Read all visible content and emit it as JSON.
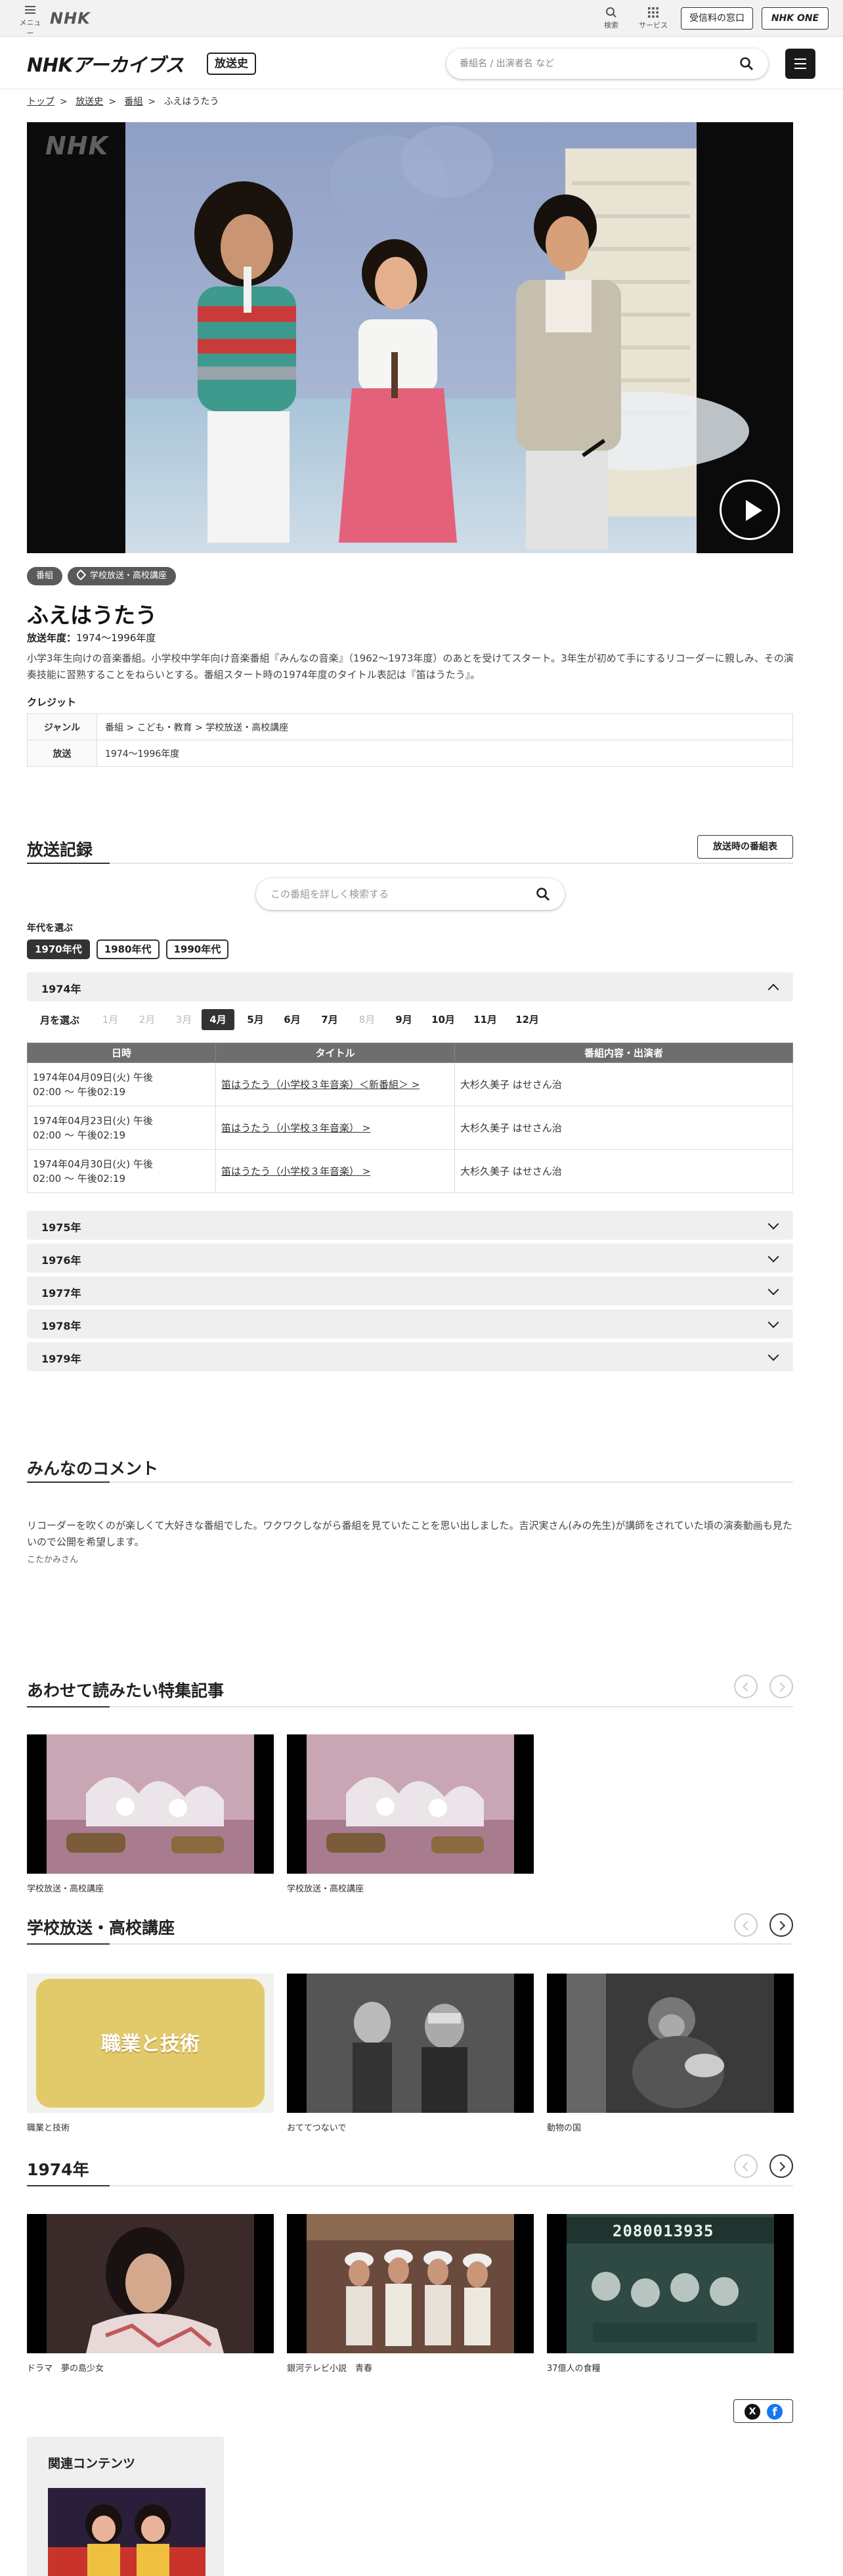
{
  "global_bar": {
    "logo": "NHK",
    "menu_label": "メニュー",
    "search_label": "検索",
    "service_label": "サービス",
    "reception_button": "受信料の窓口",
    "nhkone_button": "NHK ONE"
  },
  "header": {
    "brand": "NHKアーカイブス",
    "tag": "放送史",
    "search_placeholder": "番組名 / 出演者名 など"
  },
  "breadcrumb": [
    "トップ",
    "放送史",
    "番組",
    "ふえはうたう"
  ],
  "player": {
    "watermark": "NHK"
  },
  "program": {
    "badges": [
      "番組",
      "学校放送・高校講座"
    ],
    "title": "ふえはうたう",
    "years_label": "放送年度：",
    "years_value": "1974〜1996年度",
    "description": "小学3年生向けの音楽番組。小学校中学年向け音楽番組『みんなの音楽』（1962〜1973年度）のあとを受けてスタート。3年生が初めて手にするリコーダーに親しみ、その演奏技能に習熟することをねらいとする。番組スタート時の1974年度のタイトル表記は『笛はうたう』。",
    "credit_heading": "クレジット",
    "credits": [
      {
        "key": "ジャンル",
        "value": "番組 > こども・教育 > 学校放送・高校講座"
      },
      {
        "key": "放送",
        "value": "1974〜1996年度"
      }
    ]
  },
  "broadcast": {
    "heading": "放送記録",
    "schedule_button": "放送時の番組表",
    "search_placeholder": "この番組を詳しく検索する",
    "decade_heading": "年代を選ぶ",
    "decades": [
      "1970年代",
      "1980年代",
      "1990年代"
    ],
    "open_year": "1974年",
    "month_label": "月を選ぶ",
    "months": [
      "1月",
      "2月",
      "3月",
      "4月",
      "5月",
      "6月",
      "7月",
      "8月",
      "9月",
      "10月",
      "11月",
      "12月"
    ],
    "columns": [
      "日時",
      "タイトル",
      "番組内容・出演者"
    ],
    "rows": [
      {
        "date1": "1974年04月09日(火) 午後",
        "date2": "02:00 〜 午後02:19",
        "title": "笛はうたう（小学校３年音楽）＜新番組＞ >",
        "cast": "大杉久美子 はせさん治"
      },
      {
        "date1": "1974年04月23日(火) 午後",
        "date2": "02:00 〜 午後02:19",
        "title": "笛はうたう（小学校３年音楽） >",
        "cast": "大杉久美子 はせさん治"
      },
      {
        "date1": "1974年04月30日(火) 午後",
        "date2": "02:00 〜 午後02:19",
        "title": "笛はうたう（小学校３年音楽） >",
        "cast": "大杉久美子 はせさん治"
      }
    ],
    "closed_years": [
      "1975年",
      "1976年",
      "1977年",
      "1978年",
      "1979年"
    ]
  },
  "comments": {
    "heading": "みんなのコメント",
    "text": "リコーダーを吹くのが楽しくて大好きな番組でした。ワクワクしながら番組を見ていたことを思い出しました。吉沢実さん(みの先生)が講師をされていた頃の演奏動画も見たいので公開を希望します。",
    "author": "こたかみさん"
  },
  "features": {
    "heading": "あわせて読みたい特集記事",
    "cards": [
      "学校放送・高校講座",
      "学校放送・高校講座"
    ]
  },
  "school": {
    "heading": "学校放送・高校講座",
    "cards": [
      "職業と技術",
      "おててつないで",
      "動物の国"
    ],
    "thumb_text": "職業と技術"
  },
  "year1974": {
    "heading": "1974年",
    "cards": [
      "ドラマ　夢の島少女",
      "銀河テレビ小説　青春",
      "37億人の食糧"
    ],
    "board_text": "2080013935"
  },
  "share": {
    "x": "X",
    "fb": "f"
  },
  "related": {
    "heading": "関連コンテンツ"
  },
  "colors": {
    "dark": "#333333",
    "header_bg": "#f2f2f2",
    "table_head": "#6e6e6e",
    "accent_fb": "#1877f2"
  }
}
